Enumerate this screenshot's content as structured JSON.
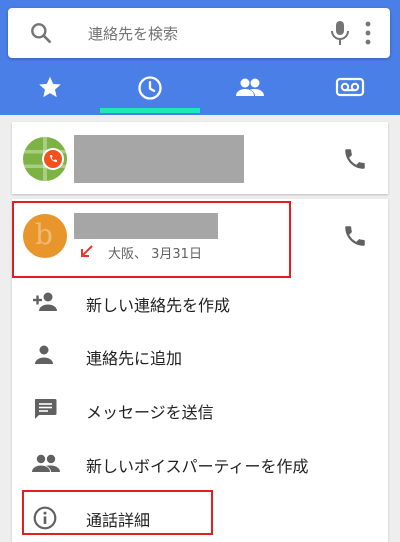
{
  "search": {
    "placeholder": "連絡先を検索",
    "icon": "search-icon",
    "mic_icon": "mic-icon",
    "more_icon": "more-vert-icon"
  },
  "tabs": [
    {
      "icon": "star-icon",
      "active": false
    },
    {
      "icon": "clock-icon",
      "active": true
    },
    {
      "icon": "people-icon",
      "active": false
    },
    {
      "icon": "voicemail-icon",
      "active": false
    }
  ],
  "colors": {
    "header": "#4a7fe8",
    "tab_indicator": "#1de9b6",
    "highlight": "#e02020",
    "missed_call": "#e53935"
  },
  "recent_calls": [
    {
      "avatar_color": "#7cb342",
      "name_redacted": true
    },
    {
      "avatar_color": "#e8952b",
      "name_redacted": true,
      "call_detail": "大阪、 3月31日"
    }
  ],
  "menu": [
    {
      "icon": "person-add-icon",
      "label": "新しい連絡先を作成"
    },
    {
      "icon": "person-icon",
      "label": "連絡先に追加"
    },
    {
      "icon": "message-icon",
      "label": "メッセージを送信"
    },
    {
      "icon": "group-icon",
      "label": "新しいボイスパーティーを作成"
    },
    {
      "icon": "info-icon",
      "label": "通話詳細"
    }
  ]
}
